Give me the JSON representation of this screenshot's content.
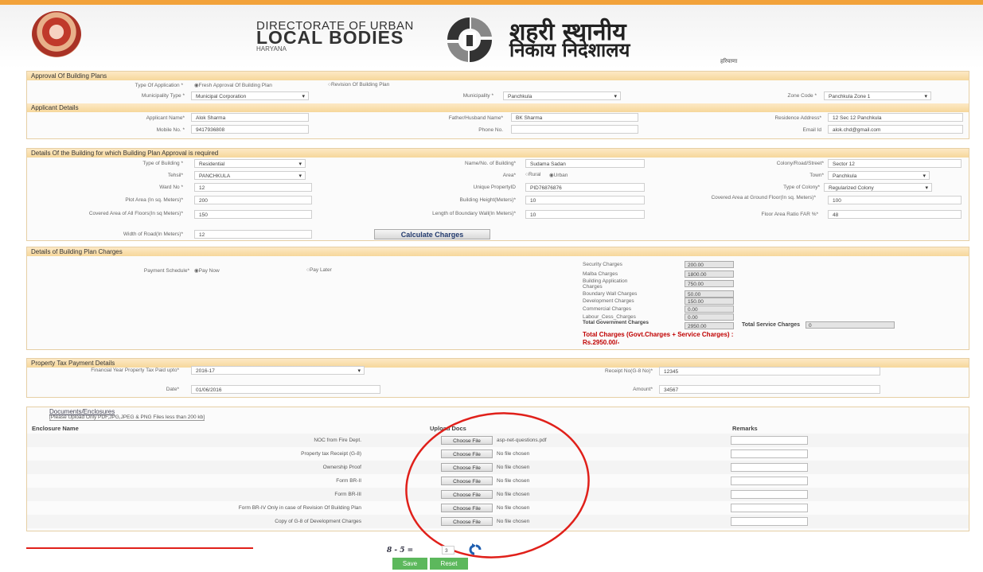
{
  "header": {
    "dir_top": "DIRECTORATE OF URBAN",
    "dir_main": "LOCAL BODIES",
    "dir_sub": "HARYANA",
    "hindi_line1": "शहरी स्थानीय",
    "hindi_line2": "निकाय निदेशालय",
    "hindi_line3": "हरियाणा"
  },
  "approval": {
    "title": "Approval Of Building Plans",
    "type_label": "Type Of Application *",
    "type_opt1": "Fresh Approval Of Building Plan",
    "type_opt2": "Revision Of Building Plan",
    "muni_type_label": "Municipality Type *",
    "muni_type_value": "Municipal Corporation",
    "muni_label": "Municipality *",
    "muni_value": "Panchkula",
    "zone_label": "Zone Code *",
    "zone_value": "Panchkula Zone 1"
  },
  "applicant": {
    "title": "Applicant Details",
    "name_label": "Applicant Name*",
    "name_value": "Alok Sharma",
    "father_label": "Father/Husband Name*",
    "father_value": "BK Sharma",
    "address_label": "Residence Address*",
    "address_value": "12 Sec 12 Panchkula",
    "mobile_label": "Mobile No. *",
    "mobile_value": "9417936808",
    "phone_label": "Phone No.",
    "phone_value": "",
    "email_label": "Email Id",
    "email_value": "alok.chd@gmail.com"
  },
  "building": {
    "title": "Details Of the Building for which Building Plan Approval is required",
    "type_label": "Type of Building *",
    "type_value": "Residential",
    "name_label": "Name/No. of Building*",
    "name_value": "Sudama Sadan",
    "colony_label": "Colony/Road/Street*",
    "colony_value": "Sector 12",
    "tehsil_label": "Tehsil*",
    "tehsil_value": "PANCHKULA",
    "area_label": "Area*",
    "area_opt1": "Rural",
    "area_opt2": "Urban",
    "town_label": "Town*",
    "town_value": "Panchkula",
    "ward_label": "Ward No *",
    "ward_value": "12",
    "upid_label": "Unique PropertyID",
    "upid_value": "PID76876876",
    "colony_type_label": "Type of Colony*",
    "colony_type_value": "Regularized Colony",
    "plot_label": "Plot Area (In sq. Meters)*",
    "plot_value": "200",
    "height_label": "Building Height(Meters)*",
    "height_value": "10",
    "covered_ground_label": "Covered Area at Ground Floor(In sq. Meters)*",
    "covered_ground_value": "100",
    "covered_all_label": "Covered Area of All Floors(In sq Meters)*",
    "covered_all_value": "150",
    "boundary_label": "Length of Boundary Wall(In Meters)*",
    "boundary_value": "10",
    "far_label": "Floor Area Ratio FAR %*",
    "far_value": "48",
    "road_label": "Width of Road(In Meters)*",
    "road_value": "12",
    "calc_button": "Calculate Charges"
  },
  "charges": {
    "title": "Details of Building Plan Charges",
    "schedule_label": "Payment Schedule*",
    "pay_now": "Pay Now",
    "pay_later": "Pay Later",
    "items": [
      {
        "label": "Security Charges",
        "value": "200.00"
      },
      {
        "label": "Malba Charges",
        "value": "1800.00"
      },
      {
        "label": "Building Application Charges",
        "value": "750.00"
      },
      {
        "label": "Boundary Wall Charges",
        "value": "50.00"
      },
      {
        "label": "Development Charges",
        "value": "150.00"
      },
      {
        "label": "Commercial Charges",
        "value": "0.00"
      },
      {
        "label": "Labour_Cess_Charges",
        "value": "0.00"
      },
      {
        "label": "Total Government Charges",
        "value": "2950.00"
      }
    ],
    "service_label": "Total Service Charges",
    "service_value": "0",
    "total_line1": "Total Charges (Govt.Charges + Service Charges) :",
    "total_line2": "Rs.2950.00/-"
  },
  "tax": {
    "title": "Property Tax Payment Details",
    "fy_label": "Financial Year Property Tax Paid upto*",
    "fy_value": "2016-17",
    "receipt_label": "Receipt No(G-8 No)*",
    "receipt_value": "12345",
    "date_label": "Date*",
    "date_value": "01/06/2016",
    "amount_label": "Amount*",
    "amount_value": "34567"
  },
  "documents": {
    "title": "Documents/Enclosures",
    "note": "[Please Upload Only PDF,JPG,JPEG & PNG Files less than 200 kb]",
    "col_name": "Enclosure Name",
    "col_upload": "Upload Docs",
    "col_remarks": "Remarks",
    "choose_label": "Choose File",
    "rows": [
      {
        "name": "NOC from Fire Dept.",
        "file": "asp-net-questions.pdf"
      },
      {
        "name": "Property tax Receipt (G-8)",
        "file": "No file chosen"
      },
      {
        "name": "Ownership Proof",
        "file": "No file chosen"
      },
      {
        "name": "Form BR-II",
        "file": "No file chosen"
      },
      {
        "name": "Form BR-III",
        "file": "No file chosen"
      },
      {
        "name": "Form BR-IV Only in case of Revision Of Building Plan",
        "file": "No file chosen"
      },
      {
        "name": "Copy of G-8 of Development Charges",
        "file": "No file chosen"
      }
    ]
  },
  "captcha": {
    "text": "8 - 5 =",
    "answer": "3"
  },
  "buttons": {
    "save": "Save",
    "reset": "Reset"
  },
  "colors": {
    "accent": "#f2a23a",
    "panel_header": "#f6d79b",
    "total_red": "#c00000",
    "green_button": "#5cb85c",
    "annotation_red": "#e0201a"
  }
}
